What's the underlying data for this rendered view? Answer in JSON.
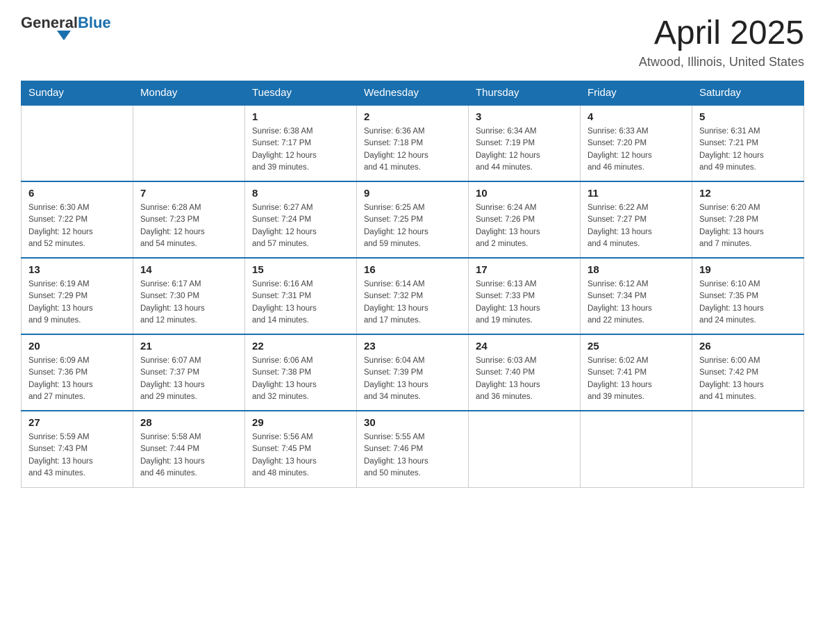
{
  "header": {
    "logo_text_general": "General",
    "logo_text_blue": "Blue",
    "page_title": "April 2025",
    "subtitle": "Atwood, Illinois, United States"
  },
  "days_of_week": [
    "Sunday",
    "Monday",
    "Tuesday",
    "Wednesday",
    "Thursday",
    "Friday",
    "Saturday"
  ],
  "weeks": [
    [
      {
        "day": "",
        "info": ""
      },
      {
        "day": "",
        "info": ""
      },
      {
        "day": "1",
        "info": "Sunrise: 6:38 AM\nSunset: 7:17 PM\nDaylight: 12 hours\nand 39 minutes."
      },
      {
        "day": "2",
        "info": "Sunrise: 6:36 AM\nSunset: 7:18 PM\nDaylight: 12 hours\nand 41 minutes."
      },
      {
        "day": "3",
        "info": "Sunrise: 6:34 AM\nSunset: 7:19 PM\nDaylight: 12 hours\nand 44 minutes."
      },
      {
        "day": "4",
        "info": "Sunrise: 6:33 AM\nSunset: 7:20 PM\nDaylight: 12 hours\nand 46 minutes."
      },
      {
        "day": "5",
        "info": "Sunrise: 6:31 AM\nSunset: 7:21 PM\nDaylight: 12 hours\nand 49 minutes."
      }
    ],
    [
      {
        "day": "6",
        "info": "Sunrise: 6:30 AM\nSunset: 7:22 PM\nDaylight: 12 hours\nand 52 minutes."
      },
      {
        "day": "7",
        "info": "Sunrise: 6:28 AM\nSunset: 7:23 PM\nDaylight: 12 hours\nand 54 minutes."
      },
      {
        "day": "8",
        "info": "Sunrise: 6:27 AM\nSunset: 7:24 PM\nDaylight: 12 hours\nand 57 minutes."
      },
      {
        "day": "9",
        "info": "Sunrise: 6:25 AM\nSunset: 7:25 PM\nDaylight: 12 hours\nand 59 minutes."
      },
      {
        "day": "10",
        "info": "Sunrise: 6:24 AM\nSunset: 7:26 PM\nDaylight: 13 hours\nand 2 minutes."
      },
      {
        "day": "11",
        "info": "Sunrise: 6:22 AM\nSunset: 7:27 PM\nDaylight: 13 hours\nand 4 minutes."
      },
      {
        "day": "12",
        "info": "Sunrise: 6:20 AM\nSunset: 7:28 PM\nDaylight: 13 hours\nand 7 minutes."
      }
    ],
    [
      {
        "day": "13",
        "info": "Sunrise: 6:19 AM\nSunset: 7:29 PM\nDaylight: 13 hours\nand 9 minutes."
      },
      {
        "day": "14",
        "info": "Sunrise: 6:17 AM\nSunset: 7:30 PM\nDaylight: 13 hours\nand 12 minutes."
      },
      {
        "day": "15",
        "info": "Sunrise: 6:16 AM\nSunset: 7:31 PM\nDaylight: 13 hours\nand 14 minutes."
      },
      {
        "day": "16",
        "info": "Sunrise: 6:14 AM\nSunset: 7:32 PM\nDaylight: 13 hours\nand 17 minutes."
      },
      {
        "day": "17",
        "info": "Sunrise: 6:13 AM\nSunset: 7:33 PM\nDaylight: 13 hours\nand 19 minutes."
      },
      {
        "day": "18",
        "info": "Sunrise: 6:12 AM\nSunset: 7:34 PM\nDaylight: 13 hours\nand 22 minutes."
      },
      {
        "day": "19",
        "info": "Sunrise: 6:10 AM\nSunset: 7:35 PM\nDaylight: 13 hours\nand 24 minutes."
      }
    ],
    [
      {
        "day": "20",
        "info": "Sunrise: 6:09 AM\nSunset: 7:36 PM\nDaylight: 13 hours\nand 27 minutes."
      },
      {
        "day": "21",
        "info": "Sunrise: 6:07 AM\nSunset: 7:37 PM\nDaylight: 13 hours\nand 29 minutes."
      },
      {
        "day": "22",
        "info": "Sunrise: 6:06 AM\nSunset: 7:38 PM\nDaylight: 13 hours\nand 32 minutes."
      },
      {
        "day": "23",
        "info": "Sunrise: 6:04 AM\nSunset: 7:39 PM\nDaylight: 13 hours\nand 34 minutes."
      },
      {
        "day": "24",
        "info": "Sunrise: 6:03 AM\nSunset: 7:40 PM\nDaylight: 13 hours\nand 36 minutes."
      },
      {
        "day": "25",
        "info": "Sunrise: 6:02 AM\nSunset: 7:41 PM\nDaylight: 13 hours\nand 39 minutes."
      },
      {
        "day": "26",
        "info": "Sunrise: 6:00 AM\nSunset: 7:42 PM\nDaylight: 13 hours\nand 41 minutes."
      }
    ],
    [
      {
        "day": "27",
        "info": "Sunrise: 5:59 AM\nSunset: 7:43 PM\nDaylight: 13 hours\nand 43 minutes."
      },
      {
        "day": "28",
        "info": "Sunrise: 5:58 AM\nSunset: 7:44 PM\nDaylight: 13 hours\nand 46 minutes."
      },
      {
        "day": "29",
        "info": "Sunrise: 5:56 AM\nSunset: 7:45 PM\nDaylight: 13 hours\nand 48 minutes."
      },
      {
        "day": "30",
        "info": "Sunrise: 5:55 AM\nSunset: 7:46 PM\nDaylight: 13 hours\nand 50 minutes."
      },
      {
        "day": "",
        "info": ""
      },
      {
        "day": "",
        "info": ""
      },
      {
        "day": "",
        "info": ""
      }
    ]
  ]
}
